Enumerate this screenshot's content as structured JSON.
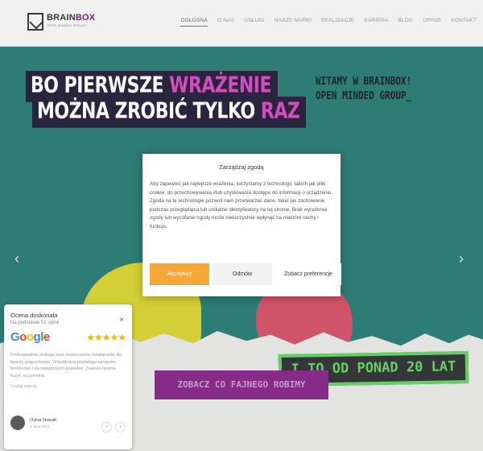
{
  "header": {
    "logo_text": "BRAIN",
    "logo_accent": "BOX",
    "logo_sub": "OPEN MINDED GROUP",
    "nav": [
      {
        "label": "OGŁOSNA",
        "active": true
      },
      {
        "label": "O NAS",
        "active": false
      },
      {
        "label": "USŁUGI",
        "active": false
      },
      {
        "label": "NASZE MARKI",
        "active": false
      },
      {
        "label": "REALIZACJE",
        "active": false
      },
      {
        "label": "KARIERA",
        "active": false
      },
      {
        "label": "BLOG",
        "active": false
      },
      {
        "label": "OPINIE",
        "active": false
      },
      {
        "label": "KONTAKT",
        "active": false
      }
    ]
  },
  "hero": {
    "headline_1a": "BO PIERWSZE ",
    "headline_1b": "WRAŻENIE",
    "headline_2a": "MOŻNA ZROBIĆ TYLKO ",
    "headline_2b": "RAZ",
    "welcome_1": "WITAMY W BRAINBOX!",
    "welcome_2": "OPEN MINDED GROUP_",
    "badge": "I TO OD PONAD 20 LAT",
    "cta": "ZOBACZ CO FAJNEGO ROBIMY",
    "prev_arrow": "‹",
    "next_arrow": "›"
  },
  "consent": {
    "title": "Zarządzaj zgodą",
    "body": "Aby zapewnić jak najlepsze wrażenia, korzystamy z technologii, takich jak pliki cookie, do przechowywania i/lub uzyskiwania dostępu do informacji o urządzeniu. Zgoda na te technologie pozwoli nam przetwarzać dane, takie jak zachowanie podczas przeglądania lub unikalne identyfikatory na tej stronie. Brak wyrażenia zgody lub wycofanie zgody może niekorzystnie wpłynąć na niektóre cechy i funkcje.",
    "accept": "Akceptuję",
    "deny": "Odmów",
    "prefs": "Zobacz preferencje"
  },
  "review": {
    "title": "Ocena doskonała",
    "subtitle": "Na podstawie 52 opinii",
    "close": "×",
    "stars": "★★★★★",
    "rating": 5,
    "text": "Profesjonalna obsługa oraz nowoczesne rozwiązania dla branży pogrzebowej. Współpraca przebiega sprawnie, terminowo i na najwyższym poziomie. Zawsze można liczyć na rzetelną",
    "more": "Czytaj więcej",
    "reviewer_name": "Oskar Nowak",
    "reviewer_date": "4 lipca 2023",
    "prev": "‹",
    "next": "›"
  },
  "colors": {
    "hero_bg": "#2e7f78",
    "accent_orange": "#f5a73a",
    "cta_purple": "#8a2c8c",
    "badge_green": "#6ad36a",
    "headline_pink": "#d94fc4"
  }
}
